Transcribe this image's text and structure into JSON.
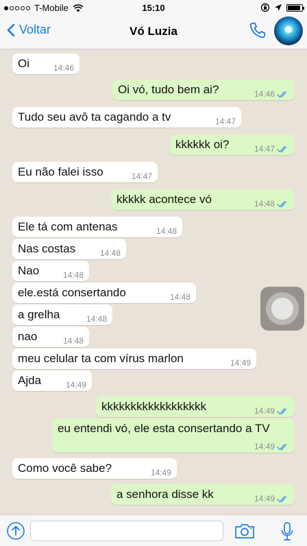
{
  "status_bar": {
    "carrier": "T-Mobile",
    "time": "15:10",
    "signal_icon": "signal-dots-icon",
    "wifi_icon": "wifi-icon",
    "orientation_icon": "orientation-lock-icon",
    "location_icon": "location-arrow-icon",
    "battery_icon": "battery-icon"
  },
  "header": {
    "back_label": "Voltar",
    "contact_name": "Vó Luzia",
    "call_icon": "phone-icon",
    "avatar": "contact-avatar"
  },
  "colors": {
    "accent": "#1b7ce0",
    "outgoing_bubble": "#dcf8c6",
    "incoming_bubble": "#ffffff",
    "read_ticks": "#4fa3e0",
    "chat_background": "#e9e2d8"
  },
  "messages": [
    {
      "direction": "in",
      "text": "Oi",
      "time": "14:46"
    },
    {
      "direction": "out",
      "text": "Oi vó, tudo bem ai?",
      "time": "14:46",
      "status": "read"
    },
    {
      "direction": "in",
      "text": "Tudo seu avô ta cagando a tv",
      "time": "14:47"
    },
    {
      "direction": "out",
      "text": "kkkkkk oi?",
      "time": "14:47",
      "status": "read"
    },
    {
      "direction": "in",
      "text": "Eu não falei isso",
      "time": "14:47"
    },
    {
      "direction": "out",
      "text": "kkkkk acontece vó",
      "time": "14:48",
      "status": "read"
    },
    {
      "direction": "in",
      "text": "Ele tá com antenas",
      "time": "14:48"
    },
    {
      "direction": "in",
      "text": "Nas costas",
      "time": "14:48"
    },
    {
      "direction": "in",
      "text": "Nao",
      "time": "14:48"
    },
    {
      "direction": "in",
      "text": "ele.está consertando",
      "time": "14:48"
    },
    {
      "direction": "in",
      "text": "a grelha",
      "time": "14:48"
    },
    {
      "direction": "in",
      "text": "nao",
      "time": "14:48"
    },
    {
      "direction": "in",
      "text": "meu celular ta com vírus marlon",
      "time": "14:49"
    },
    {
      "direction": "in",
      "text": "Ajda",
      "time": "14:49"
    },
    {
      "direction": "out",
      "text": "kkkkkkkkkkkkkkkkkk",
      "time": "14:49",
      "status": "read"
    },
    {
      "direction": "out",
      "text": "eu entendi vó, ele esta consertando a TV",
      "time": "14:49",
      "status": "read"
    },
    {
      "direction": "in",
      "text": "Como você sabe?",
      "time": "14:49"
    },
    {
      "direction": "out",
      "text": "a senhora disse kk",
      "time": "14:49",
      "status": "read"
    }
  ],
  "input_bar": {
    "share_icon": "share-upload-icon",
    "text_value": "",
    "camera_icon": "camera-icon",
    "mic_icon": "microphone-icon"
  },
  "overlay": {
    "assistive_touch_icon": "assistive-touch-icon"
  }
}
